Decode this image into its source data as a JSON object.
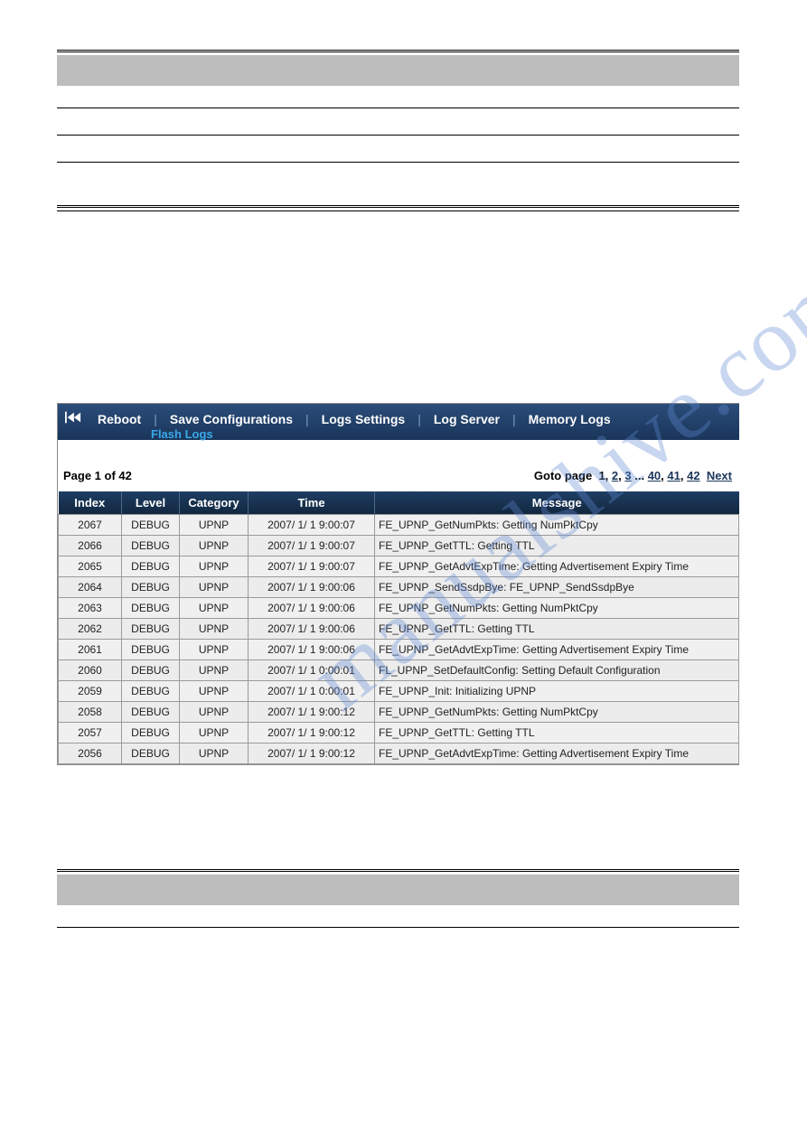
{
  "watermark": "manualshive.com",
  "menu": {
    "items": [
      {
        "label": "Reboot"
      },
      {
        "label": "Save Configurations"
      },
      {
        "label": "Logs Settings"
      },
      {
        "label": "Log Server"
      },
      {
        "label": "Memory Logs"
      }
    ],
    "rewind_icon": "rewind-icon",
    "sub_label": "Flash Logs"
  },
  "pager": {
    "page_text": "Page 1 of 42",
    "goto_label": "Goto page",
    "current": "1",
    "links": [
      "2",
      "3"
    ],
    "ellipsis": "...",
    "tail_links": [
      "40",
      "41",
      "42"
    ],
    "next": "Next"
  },
  "table": {
    "headers": [
      "Index",
      "Level",
      "Category",
      "Time",
      "Message"
    ],
    "rows": [
      {
        "index": "2067",
        "level": "DEBUG",
        "category": "UPNP",
        "time": "2007/ 1/ 1 9:00:07",
        "message": " FE_UPNP_GetNumPkts: Getting NumPktCpy"
      },
      {
        "index": "2066",
        "level": "DEBUG",
        "category": "UPNP",
        "time": "2007/ 1/ 1 9:00:07",
        "message": " FE_UPNP_GetTTL: Getting TTL"
      },
      {
        "index": "2065",
        "level": "DEBUG",
        "category": "UPNP",
        "time": "2007/ 1/ 1 9:00:07",
        "message": " FE_UPNP_GetAdvtExpTime: Getting Advertisement Expiry Time"
      },
      {
        "index": "2064",
        "level": "DEBUG",
        "category": "UPNP",
        "time": "2007/ 1/ 1 9:00:06",
        "message": " FE_UPNP_SendSsdpBye: FE_UPNP_SendSsdpBye"
      },
      {
        "index": "2063",
        "level": "DEBUG",
        "category": "UPNP",
        "time": "2007/ 1/ 1 9:00:06",
        "message": " FE_UPNP_GetNumPkts: Getting NumPktCpy"
      },
      {
        "index": "2062",
        "level": "DEBUG",
        "category": "UPNP",
        "time": "2007/ 1/ 1 9:00:06",
        "message": " FE_UPNP_GetTTL: Getting TTL"
      },
      {
        "index": "2061",
        "level": "DEBUG",
        "category": "UPNP",
        "time": "2007/ 1/ 1 9:00:06",
        "message": " FE_UPNP_GetAdvtExpTime: Getting Advertisement Expiry Time"
      },
      {
        "index": "2060",
        "level": "DEBUG",
        "category": "UPNP",
        "time": "2007/ 1/ 1 0:00:01",
        "message": " FL_UPNP_SetDefaultConfig: Setting Default Configuration"
      },
      {
        "index": "2059",
        "level": "DEBUG",
        "category": "UPNP",
        "time": "2007/ 1/ 1 0:00:01",
        "message": " FE_UPNP_Init: Initializing UPNP"
      },
      {
        "index": "2058",
        "level": "DEBUG",
        "category": "UPNP",
        "time": "2007/ 1/ 1 9:00:12",
        "message": " FE_UPNP_GetNumPkts: Getting NumPktCpy"
      },
      {
        "index": "2057",
        "level": "DEBUG",
        "category": "UPNP",
        "time": "2007/ 1/ 1 9:00:12",
        "message": " FE_UPNP_GetTTL: Getting TTL"
      },
      {
        "index": "2056",
        "level": "DEBUG",
        "category": "UPNP",
        "time": "2007/ 1/ 1 9:00:12",
        "message": " FE_UPNP_GetAdvtExpTime: Getting Advertisement Expiry Time"
      }
    ]
  }
}
